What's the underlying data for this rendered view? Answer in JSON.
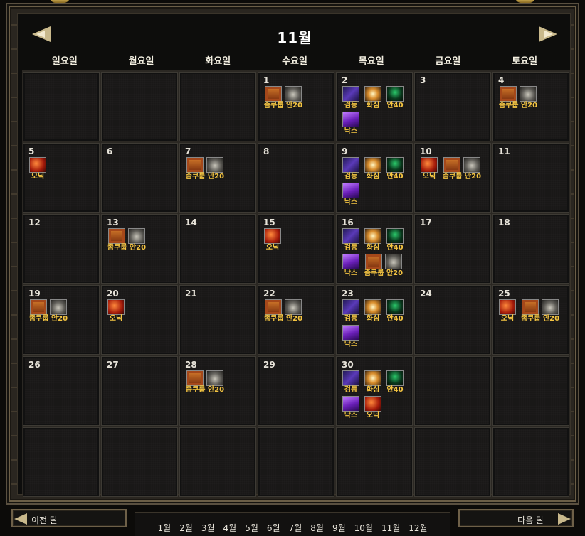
{
  "header": {
    "month_title": "11월",
    "prev_arrow": "prev-month",
    "next_arrow": "next-month"
  },
  "weekdays": [
    "일요일",
    "월요일",
    "화요일",
    "수요일",
    "목요일",
    "금요일",
    "토요일"
  ],
  "icons": {
    "chest": "treasure-chest-icon",
    "wings": "wings-icon",
    "sword": "sword-icon",
    "burst": "flame-burst-icon",
    "green": "green-spirit-icon",
    "purple": "purple-crystal-icon",
    "boss-red": "red-boss-icon"
  },
  "weeks": [
    [
      {
        "day": ""
      },
      {
        "day": ""
      },
      {
        "day": ""
      },
      {
        "day": "1",
        "events": [
          {
            "type": "wide",
            "icons": [
              "chest",
              "wings"
            ],
            "label": "좀쿠룹 안20"
          }
        ]
      },
      {
        "day": "2",
        "events": [
          {
            "type": "single",
            "icons": [
              "sword"
            ],
            "label": "검둥"
          },
          {
            "type": "single",
            "icons": [
              "burst"
            ],
            "label": "화심"
          },
          {
            "type": "single",
            "icons": [
              "green"
            ],
            "label": "안40"
          },
          {
            "type": "single",
            "icons": [
              "purple"
            ],
            "label": "낙스"
          }
        ]
      },
      {
        "day": "3"
      },
      {
        "day": "4",
        "events": [
          {
            "type": "wide",
            "icons": [
              "chest",
              "wings"
            ],
            "label": "좀쿠룹 안20"
          }
        ]
      }
    ],
    [
      {
        "day": "5",
        "events": [
          {
            "type": "single",
            "icons": [
              "boss-red"
            ],
            "label": "오닉"
          }
        ]
      },
      {
        "day": "6"
      },
      {
        "day": "7",
        "events": [
          {
            "type": "wide",
            "icons": [
              "chest",
              "wings"
            ],
            "label": "좀쿠룹 안20"
          }
        ]
      },
      {
        "day": "8"
      },
      {
        "day": "9",
        "events": [
          {
            "type": "single",
            "icons": [
              "sword"
            ],
            "label": "검둥"
          },
          {
            "type": "single",
            "icons": [
              "burst"
            ],
            "label": "화심"
          },
          {
            "type": "single",
            "icons": [
              "green"
            ],
            "label": "안40"
          },
          {
            "type": "single",
            "icons": [
              "purple"
            ],
            "label": "낙스"
          }
        ]
      },
      {
        "day": "10",
        "events": [
          {
            "type": "single",
            "icons": [
              "boss-red"
            ],
            "label": "오닉"
          },
          {
            "type": "wide",
            "icons": [
              "chest",
              "wings"
            ],
            "label": "좀쿠룹 안20"
          }
        ]
      },
      {
        "day": "11"
      }
    ],
    [
      {
        "day": "12"
      },
      {
        "day": "13",
        "events": [
          {
            "type": "wide",
            "icons": [
              "chest",
              "wings"
            ],
            "label": "좀쿠룹 안20"
          }
        ]
      },
      {
        "day": "14"
      },
      {
        "day": "15",
        "events": [
          {
            "type": "single",
            "icons": [
              "boss-red"
            ],
            "label": "오닉"
          }
        ]
      },
      {
        "day": "16",
        "events": [
          {
            "type": "single",
            "icons": [
              "sword"
            ],
            "label": "검둥"
          },
          {
            "type": "single",
            "icons": [
              "burst"
            ],
            "label": "화심"
          },
          {
            "type": "single",
            "icons": [
              "green"
            ],
            "label": "안40"
          },
          {
            "type": "single",
            "icons": [
              "purple"
            ],
            "label": "낙스"
          },
          {
            "type": "wide",
            "icons": [
              "chest",
              "wings"
            ],
            "label": "좀쿠룹 안20"
          }
        ]
      },
      {
        "day": "17"
      },
      {
        "day": "18"
      }
    ],
    [
      {
        "day": "19",
        "events": [
          {
            "type": "wide",
            "icons": [
              "chest",
              "wings"
            ],
            "label": "좀쿠룹 안20"
          }
        ]
      },
      {
        "day": "20",
        "events": [
          {
            "type": "single",
            "icons": [
              "boss-red"
            ],
            "label": "오닉"
          }
        ]
      },
      {
        "day": "21"
      },
      {
        "day": "22",
        "events": [
          {
            "type": "wide",
            "icons": [
              "chest",
              "wings"
            ],
            "label": "좀쿠룹 안20"
          }
        ]
      },
      {
        "day": "23",
        "events": [
          {
            "type": "single",
            "icons": [
              "sword"
            ],
            "label": "검둥"
          },
          {
            "type": "single",
            "icons": [
              "burst"
            ],
            "label": "화심"
          },
          {
            "type": "single",
            "icons": [
              "green"
            ],
            "label": "안40"
          },
          {
            "type": "single",
            "icons": [
              "purple"
            ],
            "label": "낙스"
          }
        ]
      },
      {
        "day": "24"
      },
      {
        "day": "25",
        "events": [
          {
            "type": "single",
            "icons": [
              "boss-red"
            ],
            "label": "오닉"
          },
          {
            "type": "wide",
            "icons": [
              "chest",
              "wings"
            ],
            "label": "좀쿠룹 안20"
          }
        ]
      }
    ],
    [
      {
        "day": "26"
      },
      {
        "day": "27"
      },
      {
        "day": "28",
        "events": [
          {
            "type": "wide",
            "icons": [
              "chest",
              "wings"
            ],
            "label": "좀쿠룹 안20"
          }
        ]
      },
      {
        "day": "29"
      },
      {
        "day": "30",
        "events": [
          {
            "type": "single",
            "icons": [
              "sword"
            ],
            "label": "검둥"
          },
          {
            "type": "single",
            "icons": [
              "burst"
            ],
            "label": "화심"
          },
          {
            "type": "single",
            "icons": [
              "green"
            ],
            "label": "안40"
          },
          {
            "type": "single",
            "icons": [
              "purple"
            ],
            "label": "낙스"
          },
          {
            "type": "single",
            "icons": [
              "boss-red"
            ],
            "label": "오닉"
          }
        ]
      },
      {
        "day": ""
      },
      {
        "day": ""
      }
    ],
    [
      {
        "day": ""
      },
      {
        "day": ""
      },
      {
        "day": ""
      },
      {
        "day": ""
      },
      {
        "day": ""
      },
      {
        "day": ""
      },
      {
        "day": ""
      }
    ]
  ],
  "footer": {
    "prev_label": "이전 달",
    "next_label": "다음 달",
    "months": [
      "1월",
      "2월",
      "3월",
      "4월",
      "5월",
      "6월",
      "7월",
      "8월",
      "9월",
      "10월",
      "11월",
      "12월"
    ]
  },
  "colors": {
    "event_label": "#f5c542",
    "frame": "#2a2620",
    "cell": "#191817"
  }
}
